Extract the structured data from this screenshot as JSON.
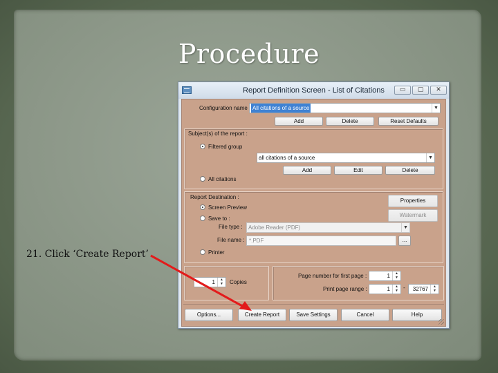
{
  "slide": {
    "title": "Procedure",
    "step_text": "21. Click ‘Create Report’",
    "arrow_color": "#e31b1b"
  },
  "window": {
    "title": "Report Definition Screen - List of Citations",
    "icon": "grid-icon",
    "controls": {
      "minimize": "▭",
      "maximize": "▢",
      "close": "✕"
    }
  },
  "config": {
    "label": "Configuration name",
    "value": "All citations of a source",
    "buttons": {
      "add": "Add",
      "delete": "Delete",
      "reset": "Reset Defaults"
    }
  },
  "subjects": {
    "label": "Subject(s) of the report :",
    "filtered_group_label": "Filtered group",
    "filtered_group_selected": true,
    "filter_value": "all citations of a source",
    "buttons": {
      "add": "Add",
      "edit": "Edit",
      "delete": "Delete"
    },
    "all_citations_label": "All citations"
  },
  "destination": {
    "label": "Report Destination :",
    "screen_preview_label": "Screen Preview",
    "screen_preview_selected": true,
    "save_to_label": "Save to :",
    "file_type_label": "File type :",
    "file_type_value": "Adobe Reader (PDF)",
    "file_name_label": "File name :",
    "file_name_value": "*.PDF",
    "browse_label": "...",
    "printer_label": "Printer",
    "properties_label": "Properties",
    "watermark_label": "Watermark"
  },
  "copies": {
    "value": "1",
    "label": "Copies"
  },
  "pages": {
    "first_page_label": "Page number for first page :",
    "first_page_value": "1",
    "range_label": "Print page range :",
    "range_from": "1",
    "range_sep": "-",
    "range_to": "32767"
  },
  "footer": {
    "options": "Options...",
    "create_report": "Create Report",
    "save_settings": "Save Settings",
    "cancel": "Cancel",
    "help": "Help"
  }
}
